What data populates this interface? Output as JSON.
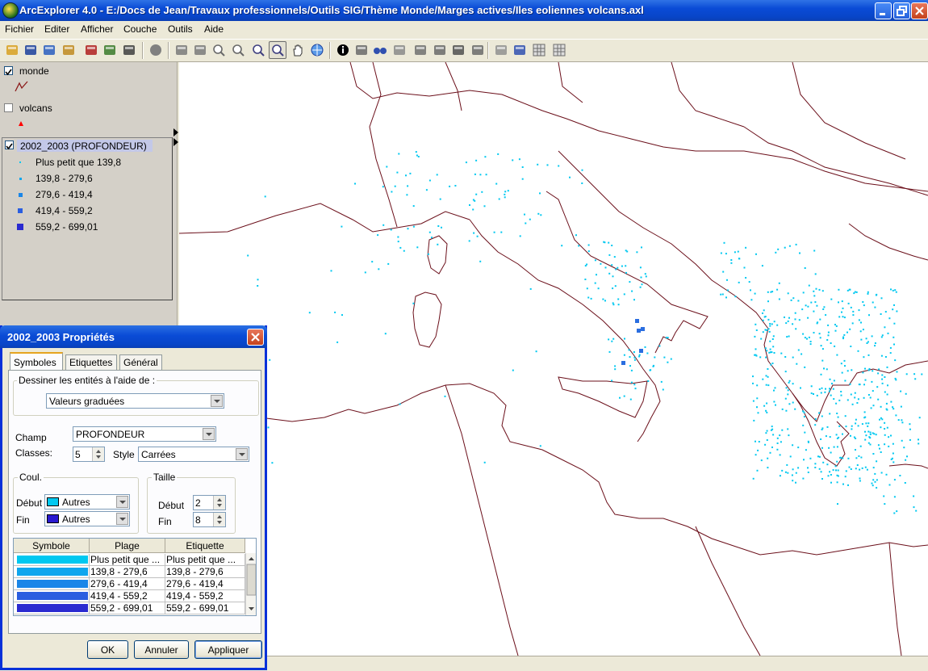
{
  "window": {
    "title": "ArcExplorer 4.0 - E:/Docs de Jean/Travaux professionnels/Outils SIG/Thème Monde/Marges actives/Iles eoliennes volcans.axl"
  },
  "menu": [
    "Fichier",
    "Editer",
    "Afficher",
    "Couche",
    "Outils",
    "Aide"
  ],
  "toolbar": {
    "tools": [
      "open-folder-icon",
      "save-icon",
      "save-all-icon",
      "open-file-icon",
      "add-layer-icon",
      "add-theme-icon",
      "print-icon",
      "stop-icon",
      "back-icon",
      "forward-icon",
      "zoom-full-icon",
      "zoom-layer-icon",
      "zoom-in-icon",
      "zoom-out-icon",
      "pan-icon",
      "globe-icon",
      "info-icon",
      "select-icon",
      "find-icon",
      "query-icon",
      "measure-icon",
      "buffer-icon",
      "label-icon",
      "properties-icon",
      "eraser-icon",
      "hyperlink-icon",
      "grid-icon",
      "table-icon"
    ],
    "active_tool": "zoom-out-icon"
  },
  "legend": {
    "layers": [
      {
        "name": "monde",
        "checked": true,
        "symbol": "line-icon",
        "color": "#8b1a1a"
      },
      {
        "name": "volcans",
        "checked": false,
        "symbol": "triangle-icon",
        "color": "#ff0000"
      },
      {
        "name": "2002_2003 (PROFONDEUR)",
        "checked": true,
        "selected": true,
        "classes": [
          {
            "label": "Plus petit que 139,8",
            "color": "#00c8f0",
            "size": 2
          },
          {
            "label": "139,8 - 279,6",
            "color": "#0fa6ee",
            "size": 3
          },
          {
            "label": "279,6 - 419,4",
            "color": "#1a86e8",
            "size": 5
          },
          {
            "label": "419,4 - 559,2",
            "color": "#2a5ee0",
            "size": 6
          },
          {
            "label": "559,2 - 699,01",
            "color": "#2a2ad0",
            "size": 8
          }
        ]
      }
    ]
  },
  "dialog": {
    "title": "2002_2003 Propriétés",
    "tabs": [
      "Symboles",
      "Etiquettes",
      "Général"
    ],
    "active_tab": "Symboles",
    "draw_group_label": "Dessiner les entités à l'aide de :",
    "draw_mode": "Valeurs graduées",
    "field_label": "Champ",
    "field_value": "PROFONDEUR",
    "classes_label": "Classes:",
    "classes_value": "5",
    "style_label": "Style",
    "style_value": "Carrées",
    "color_group_label": "Coul.",
    "color_start_label": "Début",
    "color_start_value": "Autres",
    "color_start_swatch": "#00c8f0",
    "color_end_label": "Fin",
    "color_end_value": "Autres",
    "color_end_swatch": "#2a1ad0",
    "size_group_label": "Taille",
    "size_start_label": "Début",
    "size_start_value": "2",
    "size_end_label": "Fin",
    "size_end_value": "8",
    "table": {
      "headers": [
        "Symbole",
        "Plage",
        "Etiquette"
      ],
      "rows": [
        {
          "color": "#00c8f0",
          "range": "Plus petit que ...",
          "label": "Plus petit que ..."
        },
        {
          "color": "#0fa6ee",
          "range": "139,8 - 279,6",
          "label": "139,8 - 279,6"
        },
        {
          "color": "#1a86e8",
          "range": "279,6 - 419,4",
          "label": "279,6 - 419,4"
        },
        {
          "color": "#2a5ee0",
          "range": "419,4 - 559,2",
          "label": "419,4 - 559,2"
        },
        {
          "color": "#2a2ad0",
          "range": "559,2 - 699,01",
          "label": "559,2 - 699,01"
        }
      ]
    },
    "buttons": {
      "ok": "OK",
      "cancel": "Annuler",
      "apply": "Appliquer"
    }
  },
  "map": {
    "coastline_color": "#6b0f1a",
    "point_color": "#00c8f0",
    "deep_point_color": "#2a6ee0"
  }
}
